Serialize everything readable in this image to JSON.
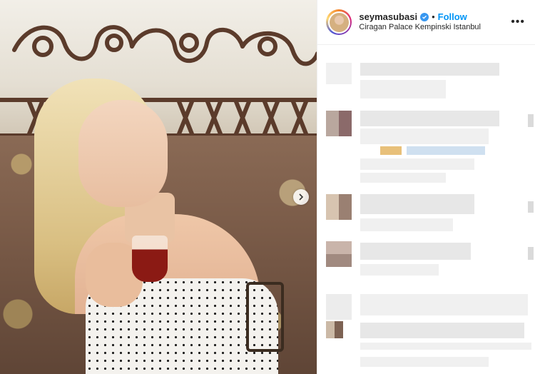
{
  "post": {
    "username": "seymasubasi",
    "separator": "•",
    "follow_label": "Follow",
    "location": "Ciragan Palace Kempinski Istanbul",
    "more_label": "•••"
  },
  "colors": {
    "follow": "#0095f6",
    "verified": "#3897f0",
    "text": "#262626"
  },
  "icons": {
    "verified": "verified-badge-icon",
    "next": "chevron-right-icon",
    "more": "more-options-icon"
  }
}
